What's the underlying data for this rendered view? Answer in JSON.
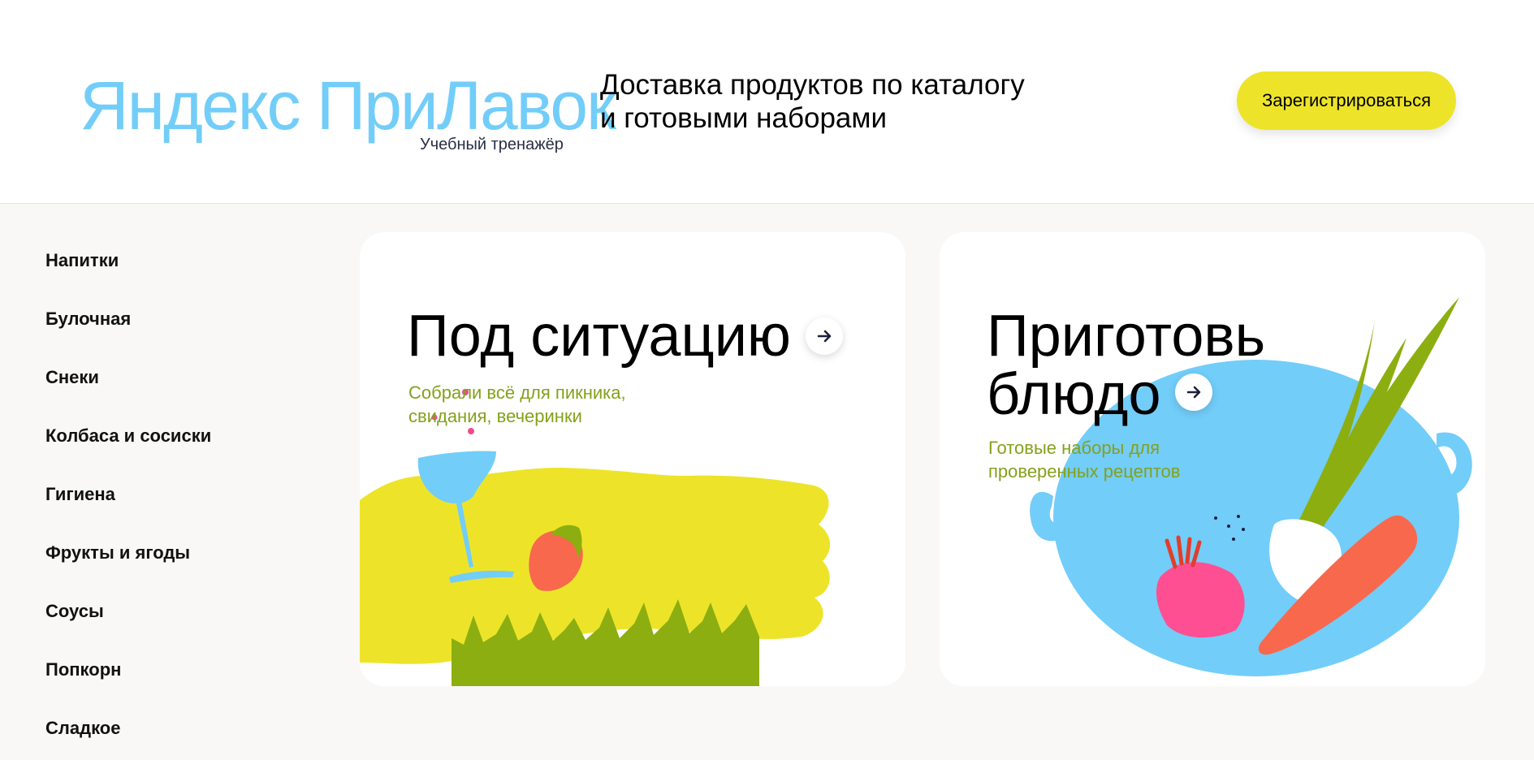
{
  "header": {
    "logo": "Яндекс ПриЛавок",
    "logo_subtitle": "Учебный тренажёр",
    "tagline_line1": "Доставка продуктов по каталогу",
    "tagline_line2": "и готовыми наборами",
    "register_label": "Зарегистрироваться"
  },
  "sidebar": {
    "items": [
      {
        "label": "Напитки"
      },
      {
        "label": "Булочная"
      },
      {
        "label": "Снеки"
      },
      {
        "label": "Колбаса и сосиски"
      },
      {
        "label": "Гигиена"
      },
      {
        "label": "Фрукты и ягоды"
      },
      {
        "label": "Соусы"
      },
      {
        "label": "Попкорн"
      },
      {
        "label": "Сладкое"
      }
    ]
  },
  "cards": [
    {
      "title": "Под ситуацию",
      "desc_line1": "Собрали всё для пикника,",
      "desc_line2": "свидания, вечеринки",
      "arrow_icon": "arrow-right-icon"
    },
    {
      "title_line1": "Приготовь",
      "title_line2": "блюдо",
      "desc_line1": "Готовые наборы для",
      "desc_line2": "проверенных рецептов",
      "arrow_icon": "arrow-right-icon"
    }
  ],
  "colors": {
    "brand_blue": "#72cdf9",
    "accent_yellow": "#ede42a",
    "desc_green": "#84a11b",
    "background": "#f9f8f7"
  }
}
